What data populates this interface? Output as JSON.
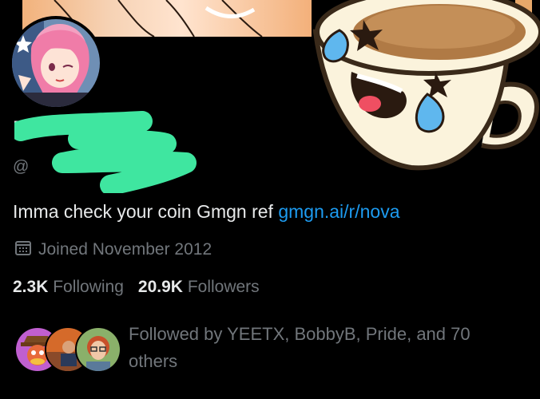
{
  "profile": {
    "name_visible": "N",
    "handle_prefix": "@",
    "bio_text": "Imma check your coin Gmgn ref ",
    "bio_link": "gmgn.ai/r/nova",
    "joined": "Joined November 2012",
    "icons": [
      "calendar-icon"
    ]
  },
  "stats": {
    "following_count": "2.3K",
    "following_label": "Following",
    "followers_count": "20.9K",
    "followers_label": "Followers"
  },
  "followed_by": {
    "text": "Followed by YEETX, BobbyB, Pride, and 70 others"
  },
  "colors": {
    "background": "#000000",
    "primary_text": "#e7e9ea",
    "secondary_text": "#71767b",
    "link": "#1d9bf0",
    "redaction": "#3fe6a0"
  }
}
